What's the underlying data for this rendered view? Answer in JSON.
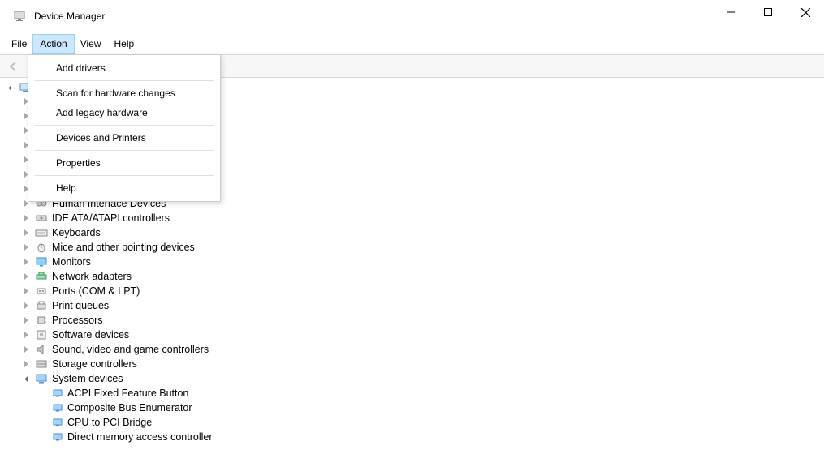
{
  "window": {
    "title": "Device Manager"
  },
  "menubar": {
    "file": "File",
    "action": "Action",
    "view": "View",
    "help": "Help"
  },
  "action_menu": {
    "add_drivers": "Add drivers",
    "scan": "Scan for hardware changes",
    "add_legacy": "Add legacy hardware",
    "devices_printers": "Devices and Printers",
    "properties": "Properties",
    "help": "Help"
  },
  "categories": [
    {
      "label": "Human Interface Devices",
      "expanded": false
    },
    {
      "label": "IDE ATA/ATAPI controllers",
      "expanded": false
    },
    {
      "label": "Keyboards",
      "expanded": false
    },
    {
      "label": "Mice and other pointing devices",
      "expanded": false
    },
    {
      "label": "Monitors",
      "expanded": false
    },
    {
      "label": "Network adapters",
      "expanded": false
    },
    {
      "label": "Ports (COM & LPT)",
      "expanded": false
    },
    {
      "label": "Print queues",
      "expanded": false
    },
    {
      "label": "Processors",
      "expanded": false
    },
    {
      "label": "Software devices",
      "expanded": false
    },
    {
      "label": "Sound, video and game controllers",
      "expanded": false
    },
    {
      "label": "Storage controllers",
      "expanded": false
    },
    {
      "label": "System devices",
      "expanded": true
    }
  ],
  "system_devices": [
    "ACPI Fixed Feature Button",
    "Composite Bus Enumerator",
    "CPU to PCI Bridge",
    "Direct memory access controller"
  ],
  "hidden_categories_count": 7,
  "icons": {
    "hid": "game-controllers",
    "ide": "drive",
    "keyboard": "keyboard",
    "mouse": "mouse",
    "monitor": "monitor",
    "network": "network",
    "ports": "serial-port",
    "print": "printer",
    "processor": "cpu",
    "software": "chip",
    "sound": "speaker",
    "storage": "storage",
    "system": "computer",
    "subdevice": "computer-small"
  }
}
